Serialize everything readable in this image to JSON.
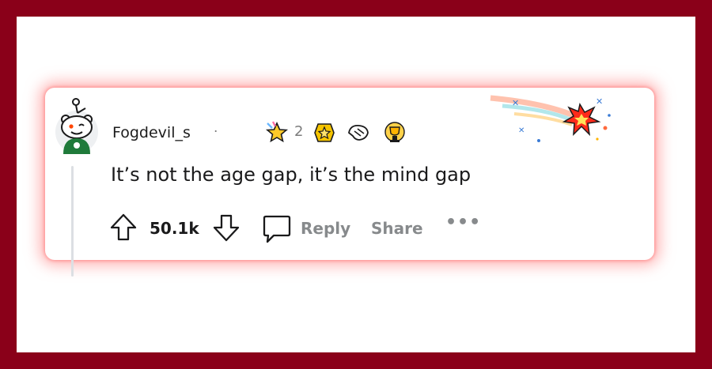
{
  "comment": {
    "username": "Fogdevil_s",
    "separator": "·",
    "text": "It’s not the age gap, it’s the mind gap"
  },
  "awards": [
    {
      "name": "rocket-like-award-icon",
      "count": "2"
    },
    {
      "name": "gold-star-award-icon"
    },
    {
      "name": "helpful-hand-award-icon"
    },
    {
      "name": "trophy-award-icon"
    }
  ],
  "actions": {
    "upvote_count": "50.1k",
    "reply_label": "Reply",
    "share_label": "Share",
    "more_label": "•••"
  },
  "colors": {
    "background": "#8a0019",
    "card_glow": "#ff7878",
    "muted_text": "#878a8c",
    "text": "#1a1a1b"
  }
}
